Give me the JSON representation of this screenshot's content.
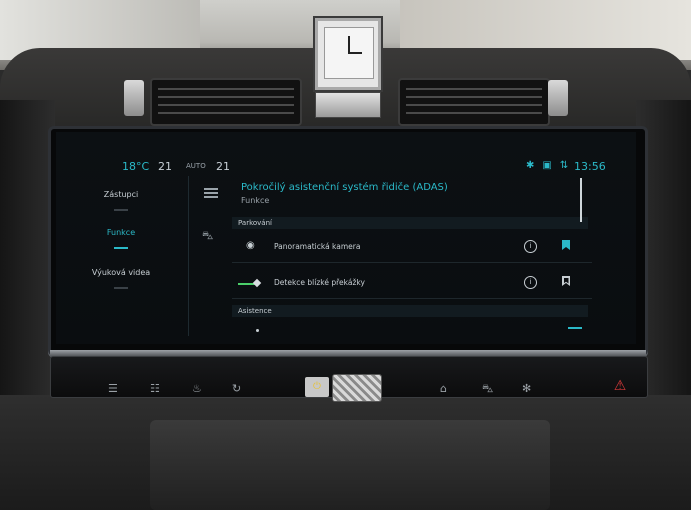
{
  "status_bar": {
    "temp_left": "18°C",
    "fan_left": "21",
    "auto_label": "AUTO",
    "temp_right": "21",
    "icons": [
      "bluetooth-icon",
      "phone-icon",
      "signal-icon"
    ],
    "time": "13:56"
  },
  "nav": {
    "items": [
      {
        "label": "Zástupci",
        "active": false
      },
      {
        "label": "Funkce",
        "active": true
      },
      {
        "label": "Výuková videa",
        "active": false
      }
    ]
  },
  "content": {
    "title": "Pokročilý asistenční systém řidiče (ADAS)",
    "subtitle": "Funkce",
    "sections": [
      {
        "label": "Parkování"
      },
      {
        "label": "Asistence"
      }
    ],
    "rows": [
      {
        "label": "Panoramatická kamera",
        "icon": "camera-icon",
        "bookmarked": true
      },
      {
        "label": "Detekce blízké překážky",
        "icon": "toggle-line-icon",
        "bookmarked": false
      }
    ],
    "info_symbol": "i"
  },
  "accent_color": "#2bb9c8",
  "strip_buttons": [
    {
      "name": "rear-defrost-icon",
      "glyph": "☰"
    },
    {
      "name": "front-defrost-icon",
      "glyph": "☷"
    },
    {
      "name": "seat-heat-icon",
      "glyph": "♨"
    },
    {
      "name": "recirculation-icon",
      "glyph": "↻"
    },
    {
      "name": "home-icon",
      "glyph": "⌂"
    },
    {
      "name": "car-icon",
      "glyph": "⛍"
    },
    {
      "name": "fan-icon",
      "glyph": "✻"
    }
  ],
  "power_symbol": "⏻",
  "hazard_symbol": "⚠"
}
